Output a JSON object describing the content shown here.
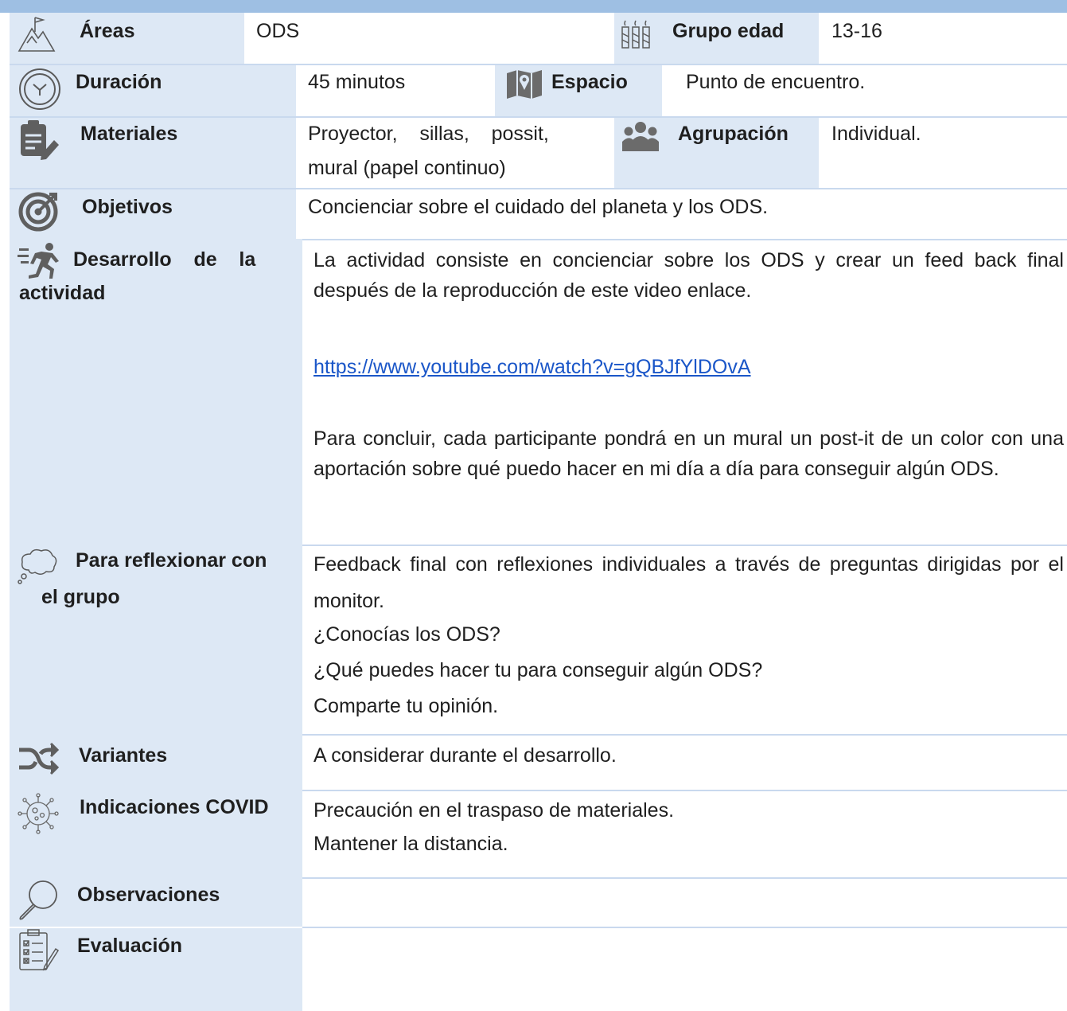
{
  "rows": {
    "areas": {
      "label": "Áreas",
      "value": "ODS",
      "icon": "mountain-flag-icon"
    },
    "grupo_edad": {
      "label": "Grupo edad",
      "value": "13-16",
      "icon": "candles-icon"
    },
    "duracion": {
      "label": "Duración",
      "value": "45 minutos",
      "icon": "clock-icon"
    },
    "espacio": {
      "label": "Espacio",
      "value": "Punto de encuentro.",
      "icon": "map-icon"
    },
    "materiales": {
      "label": "Materiales",
      "value_line1": "Proyector,    sillas,    possit,",
      "value_line2": "mural (papel continuo)",
      "icon": "clipboard-pen-icon"
    },
    "agrupacion": {
      "label": "Agrupación",
      "value": "Individual.",
      "icon": "group-icon"
    },
    "objetivos": {
      "label": "Objetivos",
      "value": "Concienciar sobre el cuidado del planeta y los ODS.",
      "icon": "target-icon"
    },
    "desarrollo": {
      "label_line1": "Desarrollo    de    la",
      "label_line2": "actividad",
      "icon": "runner-icon",
      "p1": "La actividad consiste en concienciar sobre los ODS y crear un feed back final después de la reproducción de este video enlace.",
      "link": "https://www.youtube.com/watch?v=gQBJfYlDOvA",
      "p2": "Para concluir, cada participante pondrá en un mural un post-it de un color con una aportación sobre qué puedo hacer en mi día a día para conseguir algún ODS."
    },
    "reflexionar": {
      "label_line1": "Para reflexionar con",
      "label_line2": "el grupo",
      "icon": "thought-bubble-icon",
      "p1": "Feedback final con reflexiones individuales a través de preguntas dirigidas por el monitor.",
      "q1": "¿Conocías los ODS?",
      "q2": "¿Qué puedes hacer tu para conseguir algún ODS?",
      "q3": "Comparte tu opinión."
    },
    "variantes": {
      "label": "Variantes",
      "value": "A considerar durante el desarrollo.",
      "icon": "shuffle-icon"
    },
    "covid": {
      "label": "Indicaciones COVID",
      "value_line1": "Precaución en el traspaso de materiales.",
      "value_line2": "Mantener la distancia.",
      "icon": "virus-icon"
    },
    "observaciones": {
      "label": "Observaciones",
      "value": "",
      "icon": "magnifier-icon"
    },
    "evaluacion": {
      "label": "Evaluación",
      "value": "",
      "icon": "checklist-icon"
    }
  },
  "colors": {
    "label_bg": "#dde8f5",
    "top_bar": "#9ebfe3",
    "link": "#1a56c8"
  }
}
